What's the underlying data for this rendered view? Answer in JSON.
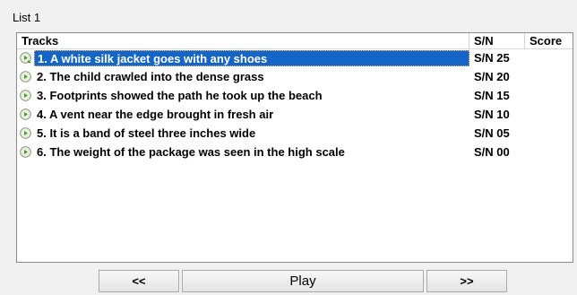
{
  "group": {
    "title": "List 1"
  },
  "list": {
    "columns": {
      "tracks": "Tracks",
      "sn": "S/N",
      "score": "Score"
    },
    "selected_index": 0,
    "rows": [
      {
        "track": "1. A white silk jacket goes with any shoes",
        "sn": "S/N 25",
        "score": "",
        "icon": "play-circle-icon"
      },
      {
        "track": "2. The child crawled into the dense grass",
        "sn": "S/N 20",
        "score": "",
        "icon": "play-circle-icon"
      },
      {
        "track": "3. Footprints showed the path he took up the beach",
        "sn": "S/N 15",
        "score": "",
        "icon": "play-circle-icon"
      },
      {
        "track": "4. A vent near the edge brought in fresh air",
        "sn": "S/N 10",
        "score": "",
        "icon": "play-circle-icon"
      },
      {
        "track": "5. It is a band of steel three inches wide",
        "sn": "S/N 05",
        "score": "",
        "icon": "play-circle-icon"
      },
      {
        "track": "6. The weight of the package was seen in the high scale",
        "sn": "S/N 00",
        "score": "",
        "icon": "play-circle-icon"
      }
    ]
  },
  "controls": {
    "prev_label": "<<",
    "play_label": "Play",
    "next_label": ">>"
  },
  "colors": {
    "selection": "#1565c8",
    "icon_green": "#5aa03c"
  }
}
